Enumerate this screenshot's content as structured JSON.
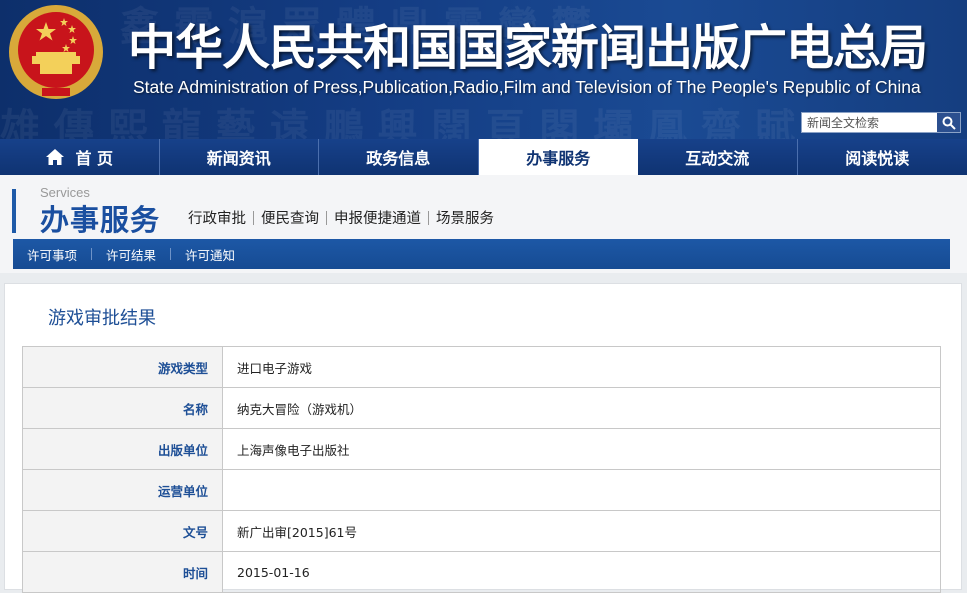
{
  "header": {
    "title_cn": "中华人民共和国国家新闻出版广电总局",
    "title_en": "State Administration of Press,Publication,Radio,Film and Television of The People's Republic of China",
    "search_placeholder": "新闻全文检索",
    "search_icon": "search-icon",
    "emblem_icon": "national-emblem-icon"
  },
  "nav": {
    "items": [
      {
        "label": "首 页",
        "icon": "home-icon"
      },
      {
        "label": "新闻资讯"
      },
      {
        "label": "政务信息"
      },
      {
        "label": "办事服务",
        "active": true
      },
      {
        "label": "互动交流"
      },
      {
        "label": "阅读悦读"
      }
    ]
  },
  "section": {
    "en": "Services",
    "cn": "办事服务",
    "tabs": [
      "行政审批",
      "便民查询",
      "申报便捷通道",
      "场景服务"
    ],
    "subnav": [
      "许可事项",
      "许可结果",
      "许可通知"
    ]
  },
  "content": {
    "title": "游戏审批结果",
    "rows": [
      {
        "label": "游戏类型",
        "value": "进口电子游戏"
      },
      {
        "label": "名称",
        "value": "纳克大冒险（游戏机）"
      },
      {
        "label": "出版单位",
        "value": "上海声像电子出版社"
      },
      {
        "label": "运营单位",
        "value": ""
      },
      {
        "label": "文号",
        "value": "新广出审[2015]61号"
      },
      {
        "label": "时间",
        "value": "2015-01-16"
      }
    ]
  },
  "colors": {
    "brand_blue": "#0f3372",
    "accent_blue": "#1e5aa8",
    "label_blue": "#1e4f96"
  }
}
